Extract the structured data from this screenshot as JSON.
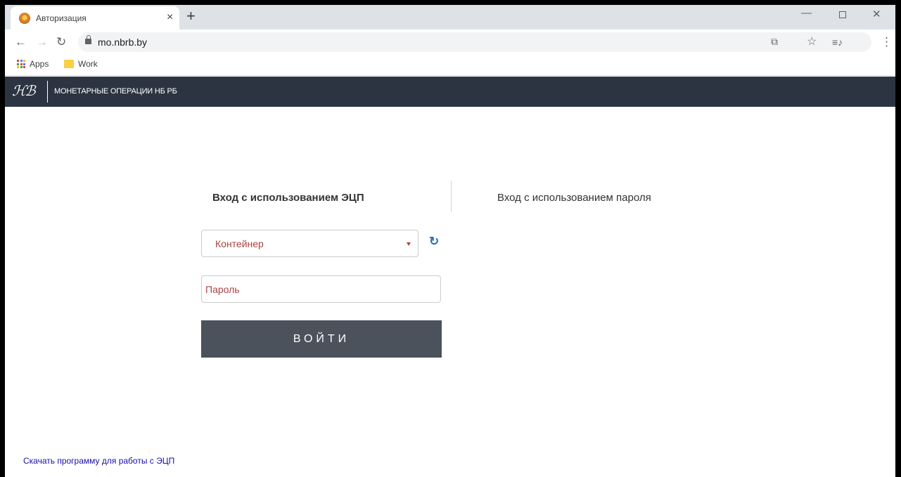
{
  "browser": {
    "tab_title": "Авторизация",
    "tab_close": "×",
    "new_tab": "+",
    "url": "mo.nbrb.by",
    "bookmarks": [
      {
        "label": "Apps"
      },
      {
        "label": "Work"
      }
    ]
  },
  "site": {
    "logo_text": "ℋℬ",
    "title": "МОНЕТАРНЫЕ ОПЕРАЦИИ НБ РБ"
  },
  "login": {
    "tab_ecp": "Вход с использованием ЭЦП",
    "tab_password": "Вход с использованием пароля",
    "container_select": "Контейнер",
    "refresh_icon": "↻",
    "password_placeholder": "Пароль",
    "submit": "ВОЙТИ"
  },
  "footer": {
    "download_link": "Скачать программу для работы с ЭЦП"
  },
  "colors": {
    "header_bg": "#2c3441",
    "button_bg": "#4b525c",
    "placeholder": "#a94442",
    "link": "#1a0dab"
  }
}
